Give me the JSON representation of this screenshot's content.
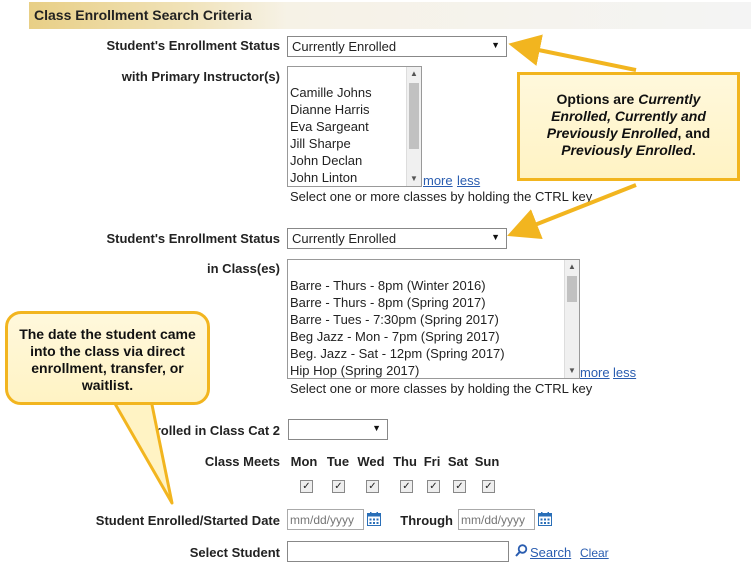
{
  "header": {
    "title": "Class Enrollment Search Criteria"
  },
  "fields": {
    "enrollment_status_1": {
      "label": "Student's Enrollment Status",
      "value": "Currently Enrolled"
    },
    "primary_instructors": {
      "label": "with Primary Instructor(s)",
      "options": [
        "Camille Johns",
        "Dianne Harris",
        "Eva Sargeant",
        "Jill Sharpe",
        "John Declan",
        "John Linton"
      ],
      "more": "more",
      "less": "less",
      "hint": "Select one or more classes by holding the CTRL key"
    },
    "enrollment_status_2": {
      "label": "Student's Enrollment Status",
      "value": "Currently Enrolled"
    },
    "classes": {
      "label": "in Class(es)",
      "options": [
        "Barre - Thurs - 8pm (Winter 2016)",
        "Barre - Thurs - 8pm (Spring 2017)",
        "Barre - Tues - 7:30pm (Spring 2017)",
        "Beg Jazz - Mon - 7pm (Spring 2017)",
        "Beg. Jazz - Sat - 12pm (Spring 2017)",
        "Hip Hop (Spring 2017)"
      ],
      "more": "more",
      "less": "less",
      "hint": "Select one or more classes by holding the CTRL key"
    },
    "class_cat2": {
      "label": "Enrolled in Class Cat 2",
      "value": ""
    },
    "class_meets": {
      "label": "Class Meets",
      "days": [
        "Mon",
        "Tue",
        "Wed",
        "Thu",
        "Fri",
        "Sat",
        "Sun"
      ],
      "checked": [
        "✓",
        "✓",
        "✓",
        "✓",
        "✓",
        "✓",
        "✓"
      ]
    },
    "started_date": {
      "label": "Student Enrolled/Started Date",
      "from_placeholder": "mm/dd/yyyy",
      "through_label": "Through",
      "to_placeholder": "mm/dd/yyyy"
    },
    "select_student": {
      "label": "Select Student",
      "value": "",
      "search": "Search",
      "clear": "Clear"
    }
  },
  "callouts": {
    "status_options": {
      "p1": "Options are ",
      "i1": "Currently Enrolled, Currently and Previously Enrolled",
      "p2": ", and ",
      "i2": "Previously Enrolled",
      "p3": "."
    },
    "date_info": "The date the student came into the class via direct enrollment, transfer, or waitlist."
  },
  "colors": {
    "accent": "#e8cf86",
    "callout_border": "#f2b51f",
    "link": "#2a5db0"
  }
}
